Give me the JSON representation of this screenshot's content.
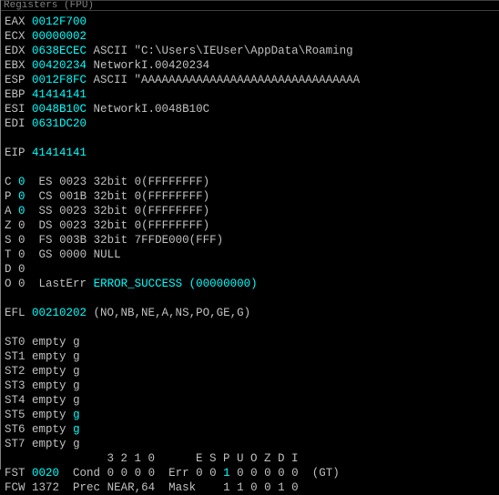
{
  "title": "Registers (FPU)",
  "regs": {
    "EAX": {
      "v": "0012F700",
      "d": ""
    },
    "ECX": {
      "v": "00000002",
      "d": ""
    },
    "EDX": {
      "v": "0638ECEC",
      "d": "ASCII \"C:\\Users\\IEUser\\AppData\\Roaming"
    },
    "EBX": {
      "v": "00420234",
      "d": "NetworkI.00420234"
    },
    "ESP": {
      "v": "0012F8FC",
      "d": "ASCII \"AAAAAAAAAAAAAAAAAAAAAAAAAAAAAAAA"
    },
    "EBP": {
      "v": "41414141",
      "d": ""
    },
    "ESI": {
      "v": "0048B10C",
      "d": "NetworkI.0048B10C"
    },
    "EDI": {
      "v": "0631DC20",
      "d": ""
    }
  },
  "eip": {
    "v": "41414141"
  },
  "flags": [
    {
      "n": "C",
      "v": "0",
      "seg": "ES",
      "sel": "0023",
      "d": "32bit 0(FFFFFFFF)"
    },
    {
      "n": "P",
      "v": "0",
      "seg": "CS",
      "sel": "001B",
      "d": "32bit 0(FFFFFFFF)"
    },
    {
      "n": "A",
      "v": "0",
      "seg": "SS",
      "sel": "0023",
      "d": "32bit 0(FFFFFFFF)"
    },
    {
      "n": "Z",
      "v": "0",
      "seg": "DS",
      "sel": "0023",
      "d": "32bit 0(FFFFFFFF)"
    },
    {
      "n": "S",
      "v": "0",
      "seg": "FS",
      "sel": "003B",
      "d": "32bit 7FFDE000(FFF)"
    },
    {
      "n": "T",
      "v": "0",
      "seg": "GS",
      "sel": "0000",
      "d": "NULL"
    },
    {
      "n": "D",
      "v": "0",
      "seg": "",
      "sel": "",
      "d": ""
    },
    {
      "n": "O",
      "v": "0",
      "seg": "",
      "sel": "",
      "d": "",
      "lasterr": "ERROR_SUCCESS (00000000)"
    }
  ],
  "efl": {
    "v": "00210202",
    "d": "(NO,NB,NE,A,NS,PO,GE,G)"
  },
  "fpu": [
    {
      "n": "ST0",
      "s": "empty",
      "v": "g"
    },
    {
      "n": "ST1",
      "s": "empty",
      "v": "g"
    },
    {
      "n": "ST2",
      "s": "empty",
      "v": "g"
    },
    {
      "n": "ST3",
      "s": "empty",
      "v": "g"
    },
    {
      "n": "ST4",
      "s": "empty",
      "v": "g"
    },
    {
      "n": "ST5",
      "s": "empty",
      "v": "g"
    },
    {
      "n": "ST6",
      "s": "empty",
      "v": "g"
    },
    {
      "n": "ST7",
      "s": "empty",
      "v": "g"
    }
  ],
  "fstHeader": "               3 2 1 0      E S P U O Z D I",
  "fst": {
    "v": "0020",
    "cond": "0 0 0 0",
    "err": "0 0 ",
    "err1": "1",
    "err2": " 0 0 0 0 0",
    "gt": "(GT)"
  },
  "fcw": {
    "v": "1372",
    "prec": "NEAR,64",
    "mask": "1 1 0 0 1 0"
  },
  "labels": {
    "lasterr": "LastErr",
    "cond": "Cond",
    "err": "Err",
    "prec": "Prec",
    "mask": "Mask"
  }
}
